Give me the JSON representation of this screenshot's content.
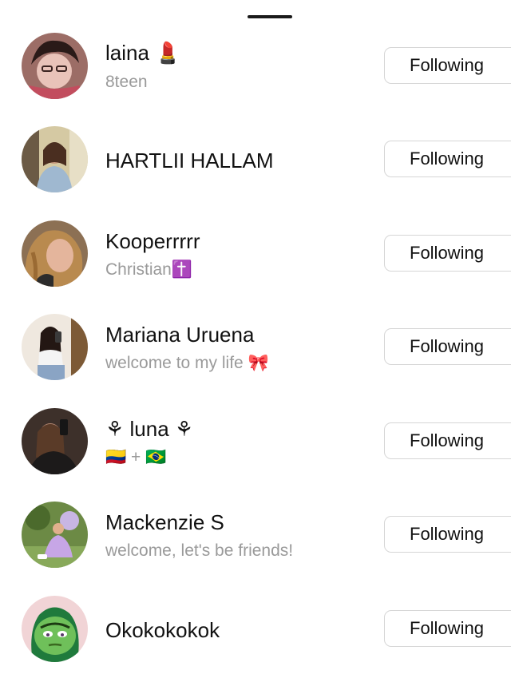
{
  "following_list": [
    {
      "name": "laina 💄",
      "bio": "8teen",
      "button_label": "Following"
    },
    {
      "name": "HARTLII HALLAM",
      "bio": "",
      "button_label": "Following"
    },
    {
      "name": "Kooperrrrr",
      "bio": "Christian✝️",
      "button_label": "Following"
    },
    {
      "name": "Mariana Uruena",
      "bio": "welcome to my life 🎀",
      "button_label": "Following"
    },
    {
      "name": "⚘ luna ⚘",
      "bio": "🇨🇴 + 🇧🇷",
      "button_label": "Following"
    },
    {
      "name": "Mackenzie S",
      "bio": "welcome, let's be friends!",
      "button_label": "Following"
    },
    {
      "name": "Okokokokok",
      "bio": "",
      "button_label": "Following"
    }
  ]
}
